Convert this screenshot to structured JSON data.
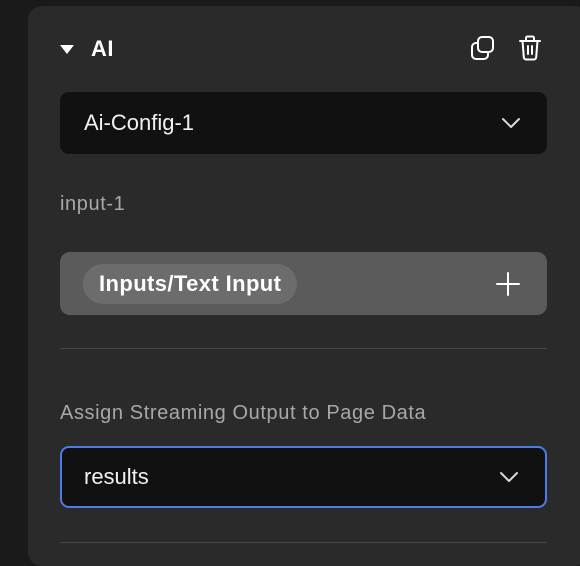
{
  "section": {
    "title": "AI",
    "icons": [
      "caret-down-icon",
      "duplicate-icon",
      "trash-icon"
    ]
  },
  "config_select": {
    "value": "Ai-Config-1"
  },
  "input_field": {
    "label": "input-1",
    "chip": "Inputs/Text Input"
  },
  "streaming_output": {
    "label": "Assign Streaming Output to Page Data",
    "value": "results"
  },
  "colors": {
    "panel_bg": "#2a2a2a",
    "select_bg": "#111111",
    "focus_border": "#4d7be8",
    "input_bg": "#5b5b5b",
    "chip_bg": "#6c6c6c"
  }
}
